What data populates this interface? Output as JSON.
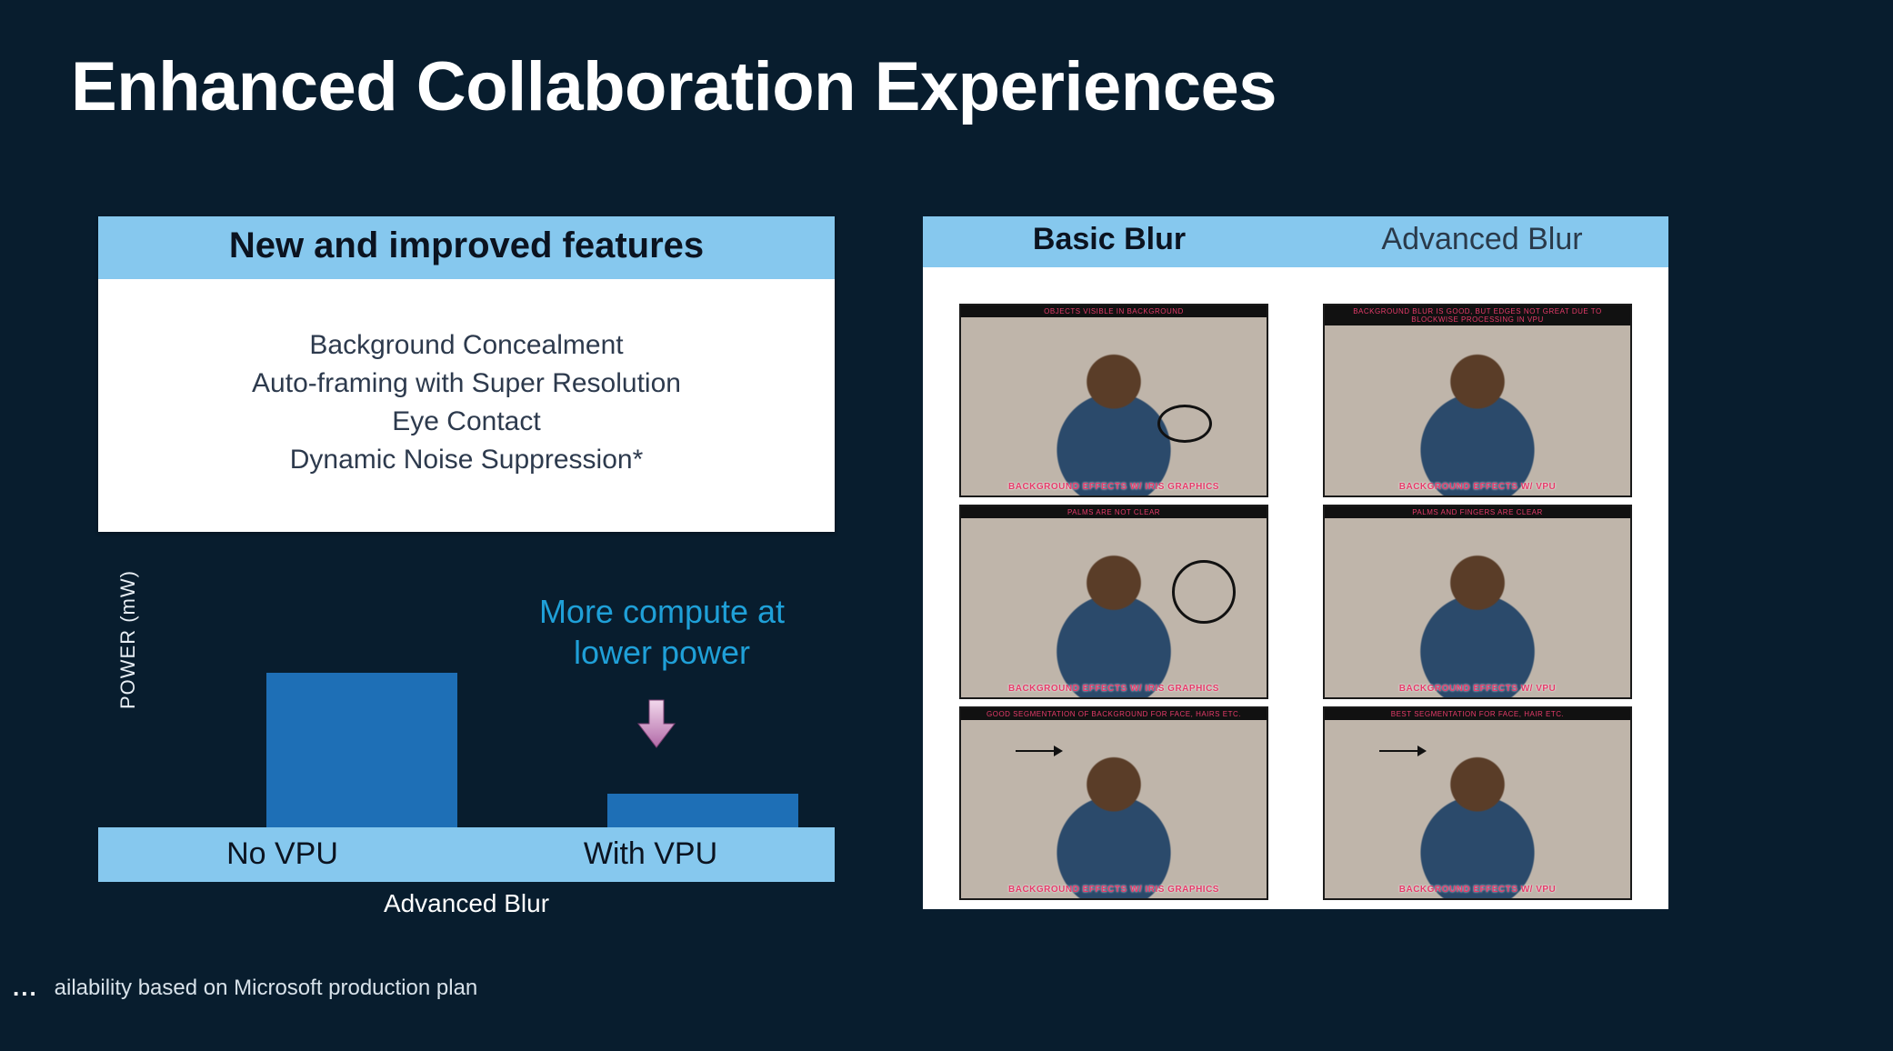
{
  "title": "Enhanced Collaboration Experiences",
  "features": {
    "header": "New and improved features",
    "items": [
      "Background Concealment",
      "Auto-framing with Super Resolution",
      "Eye Contact",
      "Dynamic Noise Suppression*"
    ]
  },
  "chart_data": {
    "type": "bar",
    "title": "Advanced Blur",
    "ylabel": "POWER (mW)",
    "categories": [
      "No VPU",
      "With VPU"
    ],
    "values": [
      100,
      22
    ],
    "ylim": [
      0,
      100
    ],
    "annotation": "More compute at lower power"
  },
  "compare": {
    "left_title": "Basic  Blur",
    "right_title": "Advanced Blur",
    "left_images": [
      {
        "top": "Objects visible in background",
        "bottom": "Background effects w/ Iris Graphics"
      },
      {
        "top": "Palms are not clear",
        "bottom": "Background effects w/ Iris Graphics"
      },
      {
        "top": "Good segmentation of background for face, hairs etc.",
        "bottom": "Background effects w/ Iris Graphics"
      }
    ],
    "right_images": [
      {
        "top": "Background blur is good, but edges not great due to blockwise processing in VPU",
        "bottom": "Background effects w/ VPU"
      },
      {
        "top": "Palms and fingers are clear",
        "bottom": "Background effects w/ VPU"
      },
      {
        "top": "Best segmentation for face, hair etc.",
        "bottom": "Background effects w/ VPU"
      }
    ]
  },
  "footer": {
    "ellipsis": "...",
    "text": "ailability based on Microsoft production plan"
  },
  "colors": {
    "bg": "#081d2e",
    "header_bar": "#86c8ee",
    "bar": "#1e6fb6",
    "accent_text": "#1fa0d8"
  }
}
